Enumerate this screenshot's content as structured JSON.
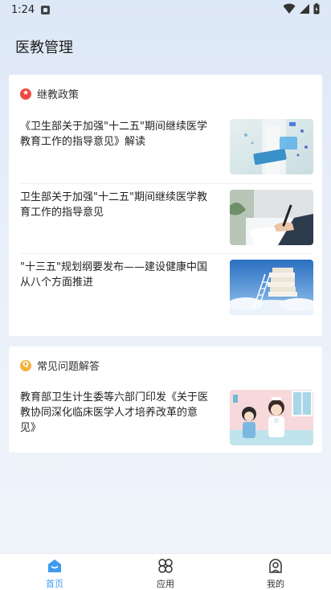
{
  "status_bar": {
    "time": "1:24"
  },
  "page_title": "医教管理",
  "policy_section": {
    "title": "继教政策",
    "articles": [
      {
        "title": "《卫生部关于加强\"十二五\"期间继续医学教育工作的指导意见》解读"
      },
      {
        "title": "卫生部关于加强\"十二五\"期间继续医学教育工作的指导意见"
      },
      {
        "title": "\"十三五\"规划纲要发布——建设健康中国从八个方面推进"
      }
    ]
  },
  "faq_section": {
    "title": "常见问题解答",
    "articles": [
      {
        "title": "教育部卫生计生委等六部门印发《关于医教协同深化临床医学人才培养改革的意见》"
      }
    ]
  },
  "tabbar": {
    "tabs": [
      {
        "label": "首页",
        "active": true,
        "icon": "home-icon"
      },
      {
        "label": "应用",
        "active": false,
        "icon": "apps-icon"
      },
      {
        "label": "我的",
        "active": false,
        "icon": "profile-icon"
      }
    ]
  },
  "colors": {
    "accent": "#3d9bf0",
    "policy_badge": "#ee4b3f",
    "faq_badge": "#f3b23a"
  }
}
